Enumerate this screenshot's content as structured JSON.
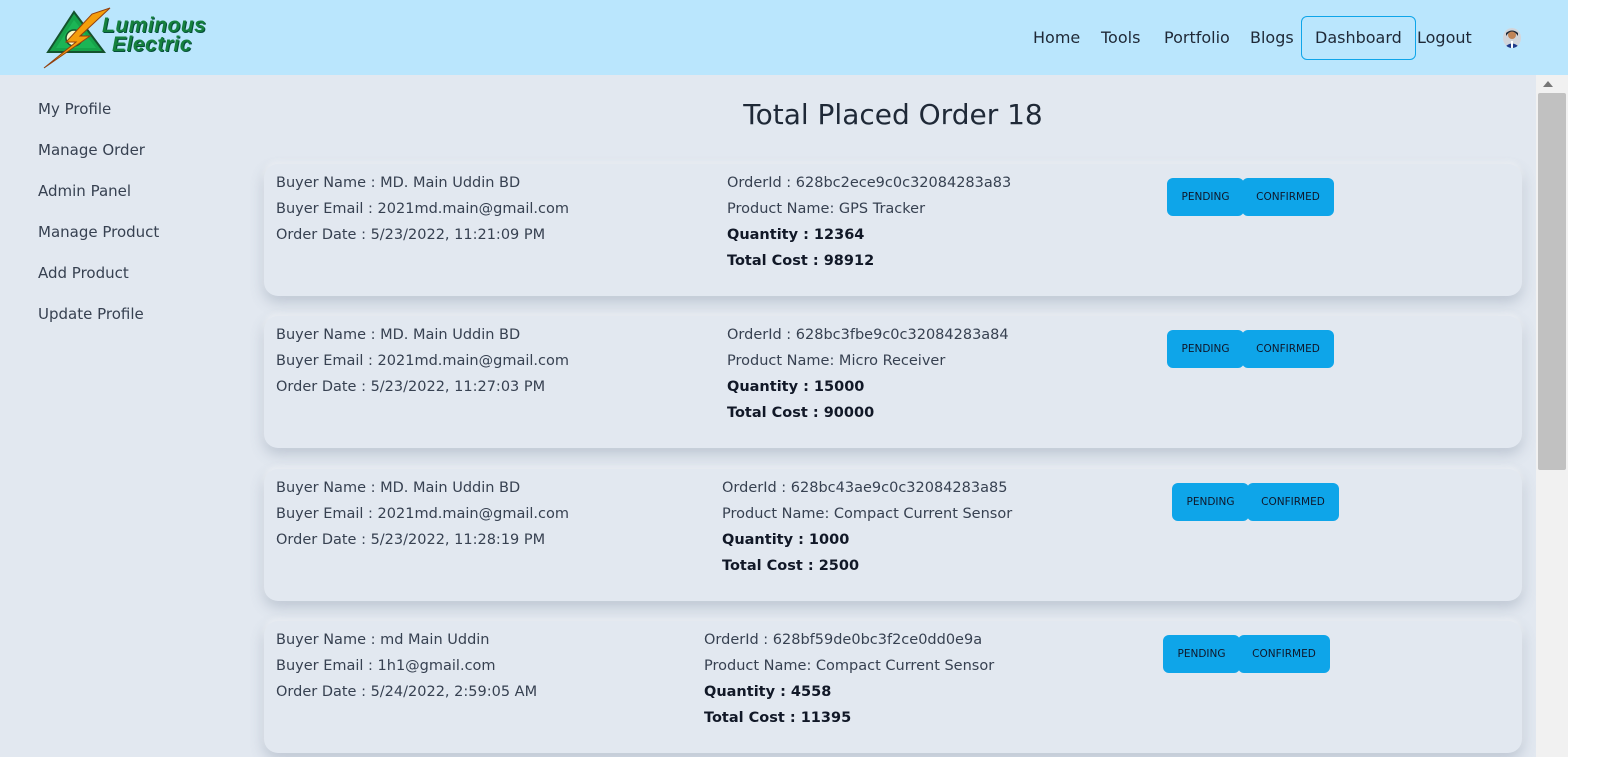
{
  "brand": {
    "line1": "Luminous",
    "line2": "Electric"
  },
  "nav": {
    "home": "Home",
    "tools": "Tools",
    "portfolio": "Portfolio",
    "blogs": "Blogs",
    "dashboard": "Dashboard",
    "logout": "Logout"
  },
  "sidebar": {
    "items": [
      {
        "label": "My Profile"
      },
      {
        "label": "Manage Order"
      },
      {
        "label": "Admin Panel"
      },
      {
        "label": "Manage Product"
      },
      {
        "label": "Add Product"
      },
      {
        "label": "Update Profile"
      }
    ]
  },
  "main": {
    "title": "Total Placed Order 18",
    "orders": [
      {
        "buyer_name": "Buyer Name : MD. Main Uddin BD",
        "buyer_email": "Buyer Email : 2021md.main@gmail.com",
        "order_date": "Order Date : 5/23/2022, 11:21:09 PM",
        "order_id": "OrderId : 628bc2ece9c0c32084283a83",
        "product_name": "Product Name: GPS Tracker",
        "quantity": "Quantity : 12364",
        "total_cost": "Total Cost : 98912",
        "pending_label": "PENDING",
        "confirmed_label": "CONFIRMED"
      },
      {
        "buyer_name": "Buyer Name : MD. Main Uddin BD",
        "buyer_email": "Buyer Email : 2021md.main@gmail.com",
        "order_date": "Order Date : 5/23/2022, 11:27:03 PM",
        "order_id": "OrderId : 628bc3fbe9c0c32084283a84",
        "product_name": "Product Name: Micro Receiver",
        "quantity": "Quantity : 15000",
        "total_cost": "Total Cost : 90000",
        "pending_label": "PENDING",
        "confirmed_label": "CONFIRMED"
      },
      {
        "buyer_name": "Buyer Name : MD. Main Uddin BD",
        "buyer_email": "Buyer Email : 2021md.main@gmail.com",
        "order_date": "Order Date : 5/23/2022, 11:28:19 PM",
        "order_id": "OrderId : 628bc43ae9c0c32084283a85",
        "product_name": "Product Name: Compact Current Sensor",
        "quantity": "Quantity : 1000",
        "total_cost": "Total Cost : 2500",
        "pending_label": "PENDING",
        "confirmed_label": "CONFIRMED"
      },
      {
        "buyer_name": "Buyer Name : md Main Uddin",
        "buyer_email": "Buyer Email : 1h1@gmail.com",
        "order_date": "Order Date : 5/24/2022, 2:59:05 AM",
        "order_id": "OrderId : 628bf59de0bc3f2ce0dd0e9a",
        "product_name": "Product Name: Compact Current Sensor",
        "quantity": "Quantity : 4558",
        "total_cost": "Total Cost : 11395",
        "pending_label": "PENDING",
        "confirmed_label": "CONFIRMED"
      }
    ]
  },
  "colors": {
    "navbar": "#bae6fd",
    "background": "#e2e8f0",
    "button": "#0ea5e9",
    "brand_green": "#15803d",
    "brand_bolt": "#f59e0b"
  },
  "icons": {
    "logo": "lightning-bolt-triangle-logo",
    "user": "user-avatar"
  }
}
